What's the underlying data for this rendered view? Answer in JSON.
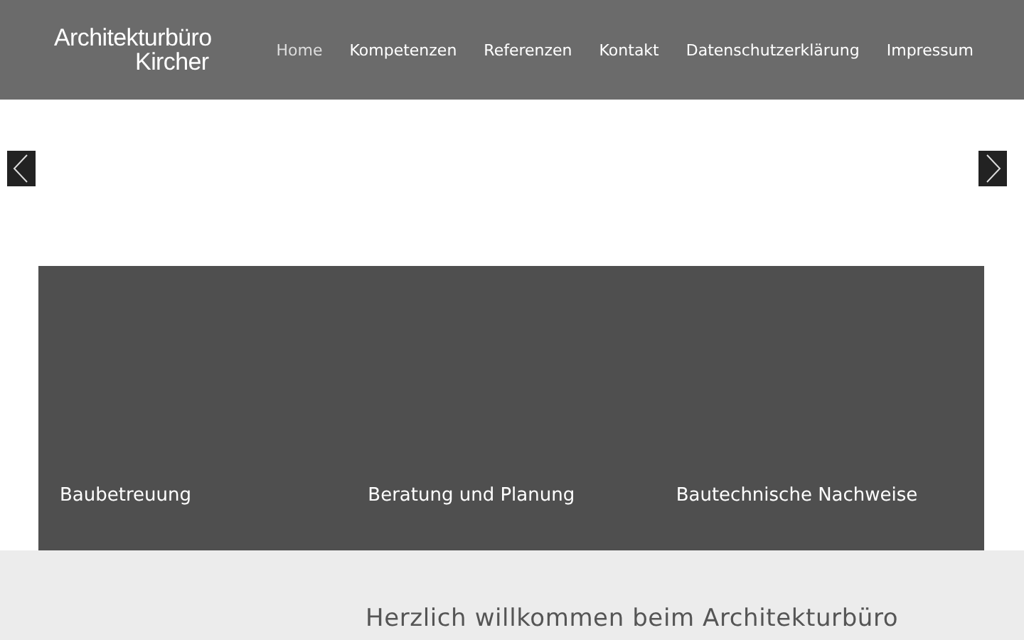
{
  "logo": {
    "line_1": "Architekturbüro",
    "line_2": "Kircher"
  },
  "nav": [
    {
      "label": "Home",
      "selected": true
    },
    {
      "label": "Kompetenzen",
      "selected": false
    },
    {
      "label": "Referenzen",
      "selected": false
    },
    {
      "label": "Kontakt",
      "selected": false
    },
    {
      "label": "Datenschutzerklärung",
      "selected": false
    },
    {
      "label": "Impressum",
      "selected": false
    }
  ],
  "services": [
    {
      "label": "Baubetreuung"
    },
    {
      "label": "Beratung und Planung"
    },
    {
      "label": "Bautechnische Nachweise"
    }
  ],
  "welcome": {
    "heading": "Herzlich willkommen beim Architekturbüro"
  }
}
